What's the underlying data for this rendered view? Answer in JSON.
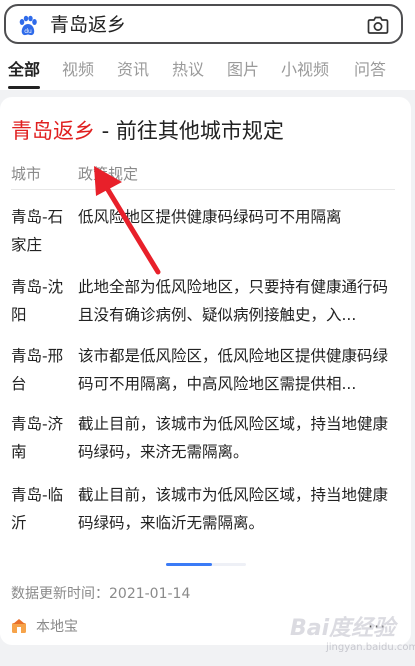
{
  "search": {
    "query": "青岛返乡"
  },
  "tabs": [
    {
      "label": "全部"
    },
    {
      "label": "视频"
    },
    {
      "label": "资讯"
    },
    {
      "label": "热议"
    },
    {
      "label": "图片"
    },
    {
      "label": "小视频"
    },
    {
      "label": "问答"
    }
  ],
  "card": {
    "title_highlight": "青岛返乡",
    "title_rest": " - 前往其他城市规定",
    "header": {
      "city": "城市",
      "policy": "政策规定"
    },
    "rows": [
      {
        "city": "青岛-石家庄",
        "policy": "低风险地区提供健康码绿码可不用隔离"
      },
      {
        "city": "青岛-沈阳",
        "policy": "此地全部为低风险地区，只要持有健康通行码且没有确诊病例、疑似病例接触史，入..."
      },
      {
        "city": "青岛-邢台",
        "policy": "该市都是低风险区，低风险地区提供健康码绿码可不用隔离，中高风险地区需提供相..."
      },
      {
        "city": "青岛-济南",
        "policy": "截止目前，该城市为低风险区域，持当地健康码绿码，来济无需隔离。"
      },
      {
        "city": "青岛-临沂",
        "policy": "截止目前，该城市为低风险区域，持当地健康码绿码，来临沂无需隔离。"
      }
    ],
    "updated": "数据更新时间：2021-01-14",
    "source": "本地宝",
    "more": "···"
  },
  "watermark": {
    "main": "Bai度经验",
    "sub": "jingyan.baidu.com"
  },
  "colors": {
    "highlight": "#e02020",
    "accent": "#3b7bf6",
    "arrow": "#e8202a"
  }
}
